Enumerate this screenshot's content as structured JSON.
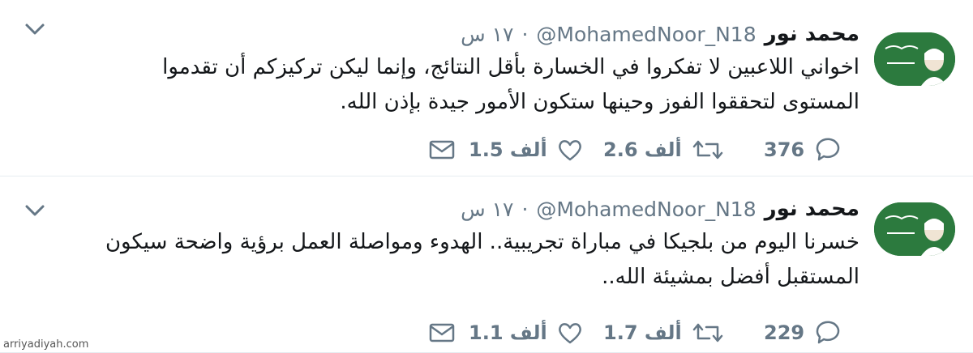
{
  "tweets": [
    {
      "name": "محمد نور",
      "handle": "@MohamedNoor_N18",
      "separator": "·",
      "time": "١٧ س",
      "text_lines": [
        "اخواني اللاعبين لا تفكروا في الخسارة بأقل النتائج، وإنما ليكن تركيزكم أن تقدموا",
        "المستوى لتحققوا الفوز وحينها ستكون الأمور جيدة بإذن الله."
      ],
      "replies": "376",
      "retweets": "2.6 ألف",
      "likes": "1.5 ألف"
    },
    {
      "name": "محمد نور",
      "handle": "@MohamedNoor_N18",
      "separator": "·",
      "time": "١٧ س",
      "text_lines": [
        "خسرنا اليوم من بلجيكا في مباراة تجريبية.. الهدوء ومواصلة العمل برؤية واضحة سيكون",
        "المستقبل أفضل بمشيئة الله.."
      ],
      "replies": "229",
      "retweets": "1.7 ألف",
      "likes": "1.1 ألف"
    }
  ],
  "watermark": "arriyadiyah.com",
  "colors": {
    "text": "#14171a",
    "muted": "#657786",
    "divider": "#e6ecf0",
    "flag_green": "#2c7a3e"
  }
}
